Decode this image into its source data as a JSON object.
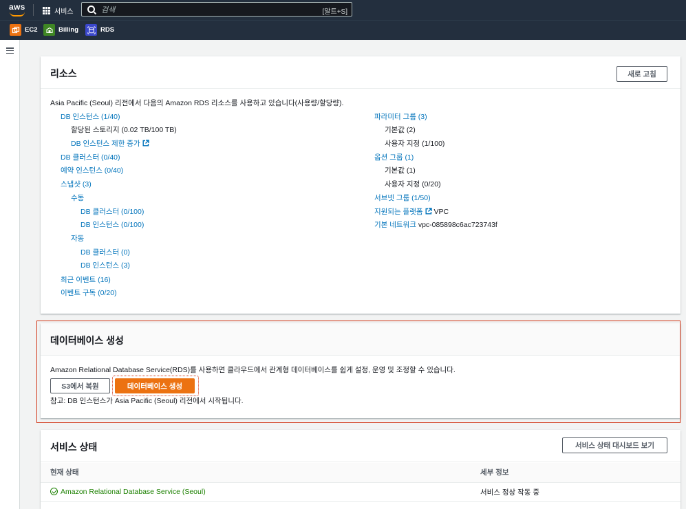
{
  "nav": {
    "logo": "aws",
    "services_label": "서비스",
    "search_placeholder": "검색",
    "search_shortcut": "[알트+S]"
  },
  "favorites": [
    {
      "label": "EC2",
      "icon": "ec2-icon",
      "color": "#ec7211"
    },
    {
      "label": "Billing",
      "icon": "billing-icon",
      "color": "#3f8624"
    },
    {
      "label": "RDS",
      "icon": "rds-icon",
      "color": "#3b48cc"
    }
  ],
  "resources": {
    "title": "리소스",
    "refresh_label": "새로 고침",
    "intro": "Asia Pacific (Seoul) 리전에서 다음의 Amazon RDS 리소스를 사용하고 있습니다(사용량/할당량).",
    "left": {
      "db_instances": "DB 인스턴스 (1/40)",
      "allocated_storage": "할당된 스토리지 (0.02 TB/100 TB)",
      "increase_limit": "DB 인스턴스 제한 증가",
      "db_clusters": "DB 클러스터 (0/40)",
      "reserved_instances": "예약 인스턴스 (0/40)",
      "snapshots": "스냅샷 (3)",
      "manual": "수동",
      "manual_clusters": "DB 클러스터 (0/100)",
      "manual_instances": "DB 인스턴스 (0/100)",
      "automated": "자동",
      "auto_clusters": "DB 클러스터 (0)",
      "auto_instances": "DB 인스턴스 (3)",
      "recent_events": "최근 이벤트 (16)",
      "event_subscriptions": "이벤트 구독 (0/20)"
    },
    "right": {
      "parameter_groups": "파라미터 그룹 (3)",
      "pg_default": "기본값 (2)",
      "pg_custom": "사용자 지정 (1/100)",
      "option_groups": "옵션 그룹 (1)",
      "og_default": "기본값 (1)",
      "og_custom": "사용자 지정 (0/20)",
      "subnet_groups": "서브넷 그룹 (1/50)",
      "supported_platforms": "지원되는 플랫폼",
      "supported_platforms_value": "VPC",
      "default_network": "기본 네트워크",
      "default_network_value": "vpc-085898c6ac723743f"
    }
  },
  "create_db": {
    "title": "데이터베이스 생성",
    "description": "Amazon Relational Database Service(RDS)를 사용하면 클라우드에서 관계형 데이터베이스를 쉽게 설정, 운영 및 조정할 수 있습니다.",
    "restore_label": "S3에서 복원",
    "create_label": "데이터베이스 생성",
    "note": "참고: DB 인스턴스가 Asia Pacific (Seoul) 리전에서 시작됩니다."
  },
  "service_health": {
    "title": "서비스 상태",
    "dashboard_label": "서비스 상태 대시보드 보기",
    "columns": [
      "현재 상태",
      "세부 정보"
    ],
    "rows": [
      {
        "status": "Amazon Relational Database Service (Seoul)",
        "detail": "서비스 정상 작동 중"
      }
    ]
  },
  "colors": {
    "nav_bg": "#232f3e",
    "link": "#0073bb",
    "primary": "#ec7211",
    "highlight": "#d13212",
    "ok": "#1d8102"
  }
}
